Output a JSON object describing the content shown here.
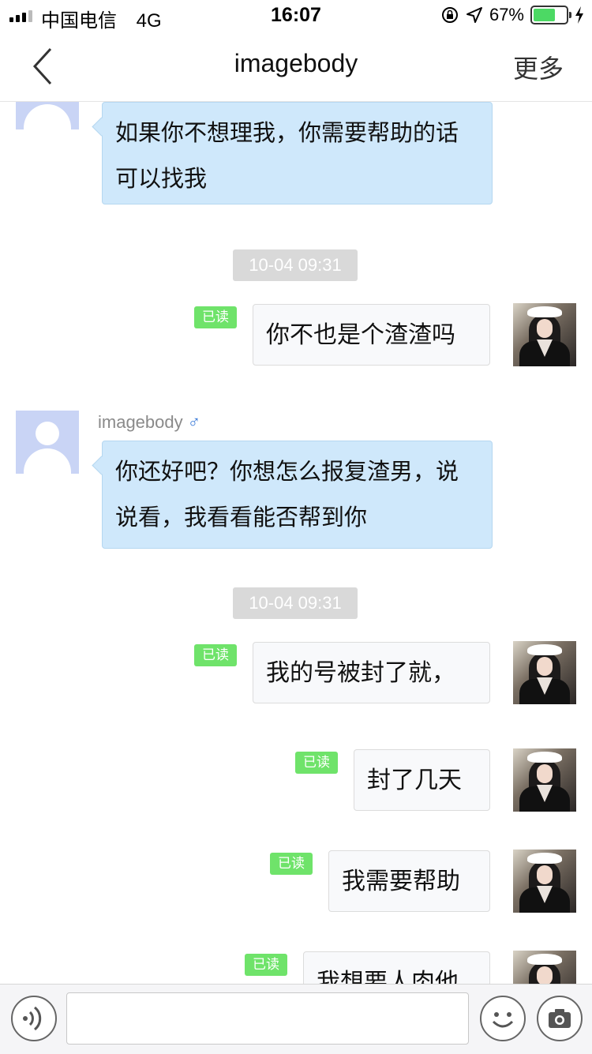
{
  "status_bar": {
    "carrier": "中国电信",
    "network": "4G",
    "time": "16:07",
    "battery_percent": "67%",
    "battery_level": 0.67
  },
  "nav": {
    "title": "imagebody",
    "more_label": "更多"
  },
  "chat": {
    "messages": [
      {
        "side": "left",
        "text": "如果你不想理我，你需要帮助的话可以找我"
      },
      {
        "type": "time",
        "text": "10-04 09:31"
      },
      {
        "side": "right",
        "read_label": "已读",
        "text": "你不也是个渣渣吗"
      },
      {
        "side": "left",
        "sender": "imagebody",
        "gender_icon": "male-icon",
        "text": "你还好吧？你想怎么报复渣男，说说看，我看看能否帮到你"
      },
      {
        "type": "time",
        "text": "10-04 09:31"
      },
      {
        "side": "right",
        "read_label": "已读",
        "text": "我的号被封了就，"
      },
      {
        "side": "right",
        "read_label": "已读",
        "text": "封了几天"
      },
      {
        "side": "right",
        "read_label": "已读",
        "text": "我需要帮助"
      },
      {
        "side": "right",
        "read_label": "已读",
        "text": "我想要人肉他"
      }
    ]
  },
  "input_bar": {
    "icons": [
      "voice-icon",
      "emoji-icon",
      "camera-icon"
    ],
    "input_value": ""
  },
  "colors": {
    "left_bubble": "#cfe8fb",
    "right_bubble": "#f8f9fb",
    "read_tag": "#6fe36a",
    "time_chip": "#d9d9d9"
  }
}
